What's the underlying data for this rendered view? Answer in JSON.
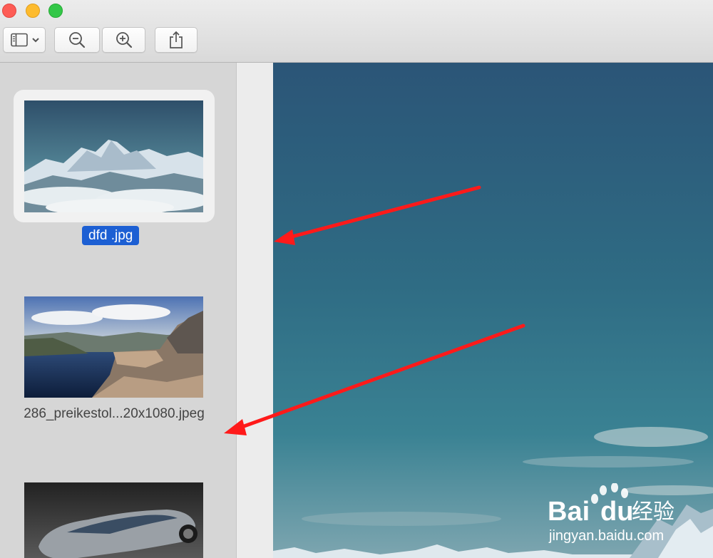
{
  "window": {
    "controls": [
      "close-button",
      "minimize-button",
      "zoom-button"
    ]
  },
  "toolbar": {
    "icons": [
      "sidebar-icon",
      "chevron-down-icon",
      "zoom-out-icon",
      "zoom-in-icon",
      "share-icon"
    ]
  },
  "sidebar": {
    "items": [
      {
        "label": "dfd .jpg",
        "selected": true,
        "thumbnail": "snowy mountain range above clouds"
      },
      {
        "label": "286_preikestol...20x1080.jpeg",
        "selected": false,
        "thumbnail": "cliff over a fjord"
      },
      {
        "label": "",
        "selected": false,
        "thumbnail": "silver convertible car"
      }
    ]
  },
  "viewer": {
    "image": "sky over snowy mountain peaks"
  },
  "annotations": {
    "arrow_color": "#ff1a1a",
    "arrow_count": 2
  },
  "watermark": {
    "brand": "Bai",
    "brand_suffix": "经验",
    "url": "jingyan.baidu.com"
  },
  "colors": {
    "selection": "#1c5fd3",
    "sidebar_bg": "#d6d6d6",
    "toolbar_bg": "#dcdcdc"
  }
}
